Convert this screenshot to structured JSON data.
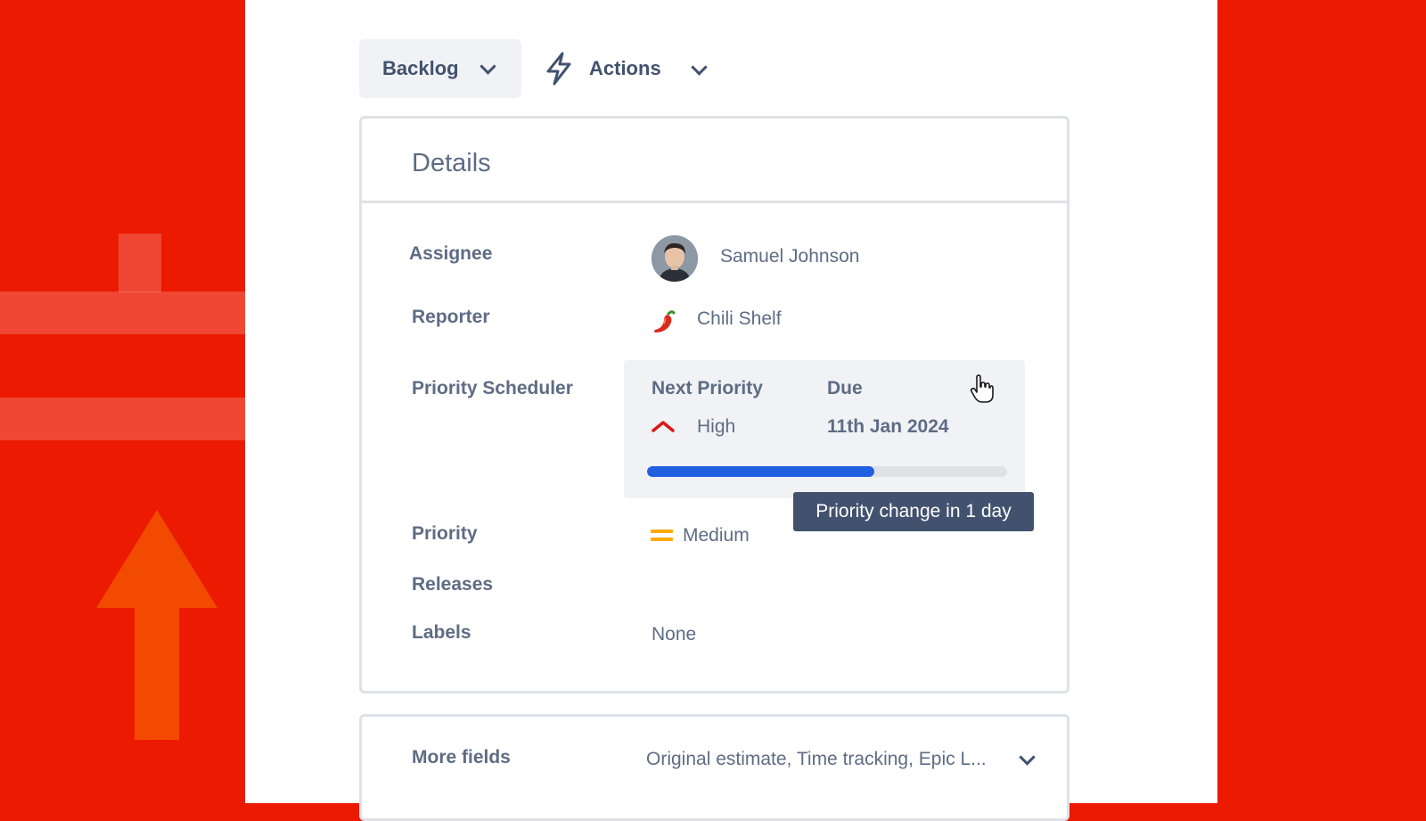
{
  "toolbar": {
    "status_label": "Backlog",
    "actions_label": "Actions"
  },
  "details": {
    "title": "Details",
    "assignee": {
      "label": "Assignee",
      "name": "Samuel Johnson"
    },
    "reporter": {
      "label": "Reporter",
      "name": "Chili Shelf",
      "icon": "chili-pepper-icon"
    },
    "scheduler": {
      "label": "Priority Scheduler",
      "next_priority_header": "Next Priority",
      "due_header": "Due",
      "next_priority_value": "High",
      "due_value": "11th Jan 2024",
      "progress_percent": 63,
      "tooltip": "Priority change in 1 day"
    },
    "priority": {
      "label": "Priority",
      "value": "Medium"
    },
    "releases": {
      "label": "Releases"
    },
    "labels": {
      "label": "Labels",
      "value": "None"
    }
  },
  "more_fields": {
    "label": "More fields",
    "value": "Original estimate, Time tracking, Epic L..."
  },
  "colors": {
    "background_red": "#eb1a00",
    "text": "#42526e",
    "progress": "#1f5fe0",
    "priority_high": "#de1616",
    "priority_medium": "#ffab00"
  }
}
